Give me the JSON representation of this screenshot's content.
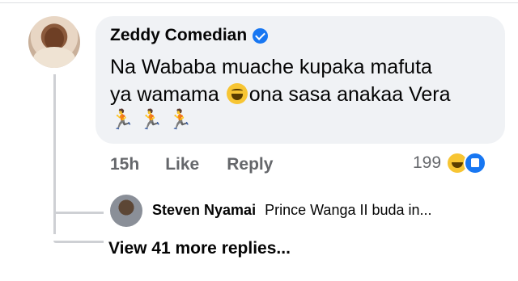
{
  "comment": {
    "author": "Zeddy Comedian",
    "text_line1": "Na Wababa muache kupaka mafuta",
    "text_line2_before": "ya wamama",
    "text_line2_after": "ona sasa anakaa Vera",
    "emoji_inline": "grinning-sweat-emoji",
    "trailing_emojis": [
      "runner-emoji",
      "runner-emoji",
      "runner-emoji"
    ],
    "verified": true
  },
  "meta": {
    "time": "15h",
    "like_label": "Like",
    "reply_label": "Reply"
  },
  "reactions": {
    "count": "199",
    "types": [
      "haha",
      "like"
    ]
  },
  "reply": {
    "author": "Steven Nyamai",
    "text": "Prince Wanga II buda in..."
  },
  "view_more": "View 41 more replies...",
  "colors": {
    "bubble": "#f0f2f5",
    "secondary_text": "#65676b",
    "accent": "#1877f2"
  }
}
